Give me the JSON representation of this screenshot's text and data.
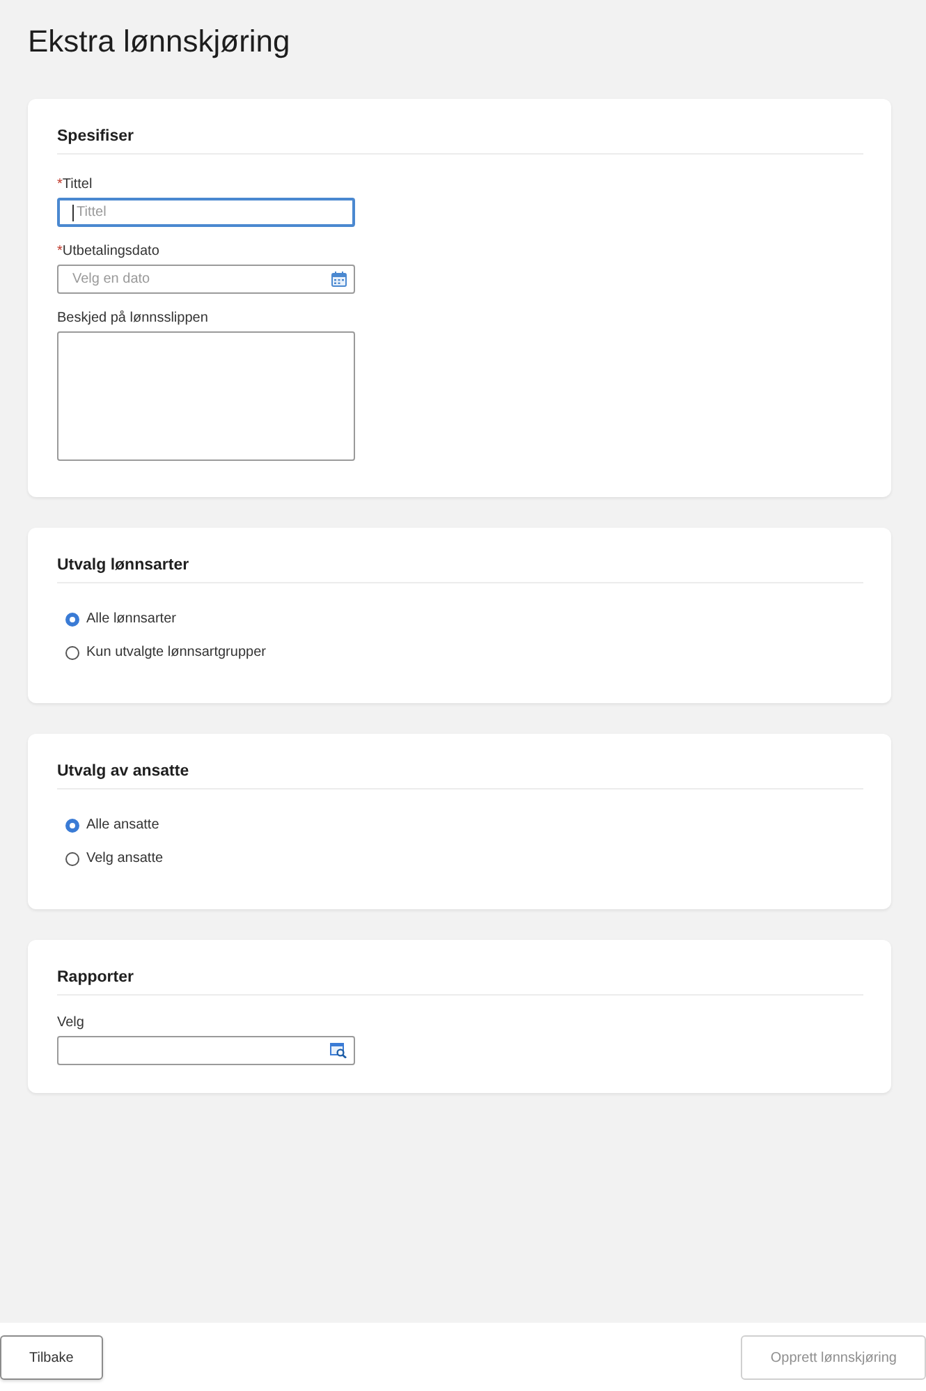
{
  "page_title": "Ekstra lønnskjøring",
  "sections": [
    {
      "kind": "form",
      "title": "Spesifiser",
      "fields": [
        {
          "kind": "text",
          "mark": "*",
          "label": "Tittel",
          "placeholder": "Tittel",
          "focused": true
        },
        {
          "kind": "date",
          "mark": "*",
          "label": "Utbetalingsdato",
          "placeholder": "Velg en dato",
          "focused": false
        },
        {
          "kind": "textarea",
          "label": "Beskjed på lønnsslippen",
          "focused": false
        }
      ]
    },
    {
      "kind": "radio",
      "title": "Utvalg lønnsarter",
      "options": [
        {
          "label": "Alle lønnsarter",
          "selected": true
        },
        {
          "label": "Kun utvalgte lønnsartgrupper",
          "selected": false
        }
      ]
    },
    {
      "kind": "radio",
      "title": "Utvalg av ansatte",
      "options": [
        {
          "label": "Alle ansatte",
          "selected": true
        },
        {
          "label": "Velg ansatte",
          "selected": false
        }
      ]
    },
    {
      "kind": "form",
      "title": "Rapporter",
      "fields": [
        {
          "kind": "lookup",
          "label": "Velg",
          "focused": false
        }
      ]
    }
  ],
  "footer": {
    "buttons": [
      {
        "label": "Tilbake",
        "disabled": false
      },
      {
        "label": "Opprett lønnskjøring",
        "disabled": true
      }
    ]
  }
}
